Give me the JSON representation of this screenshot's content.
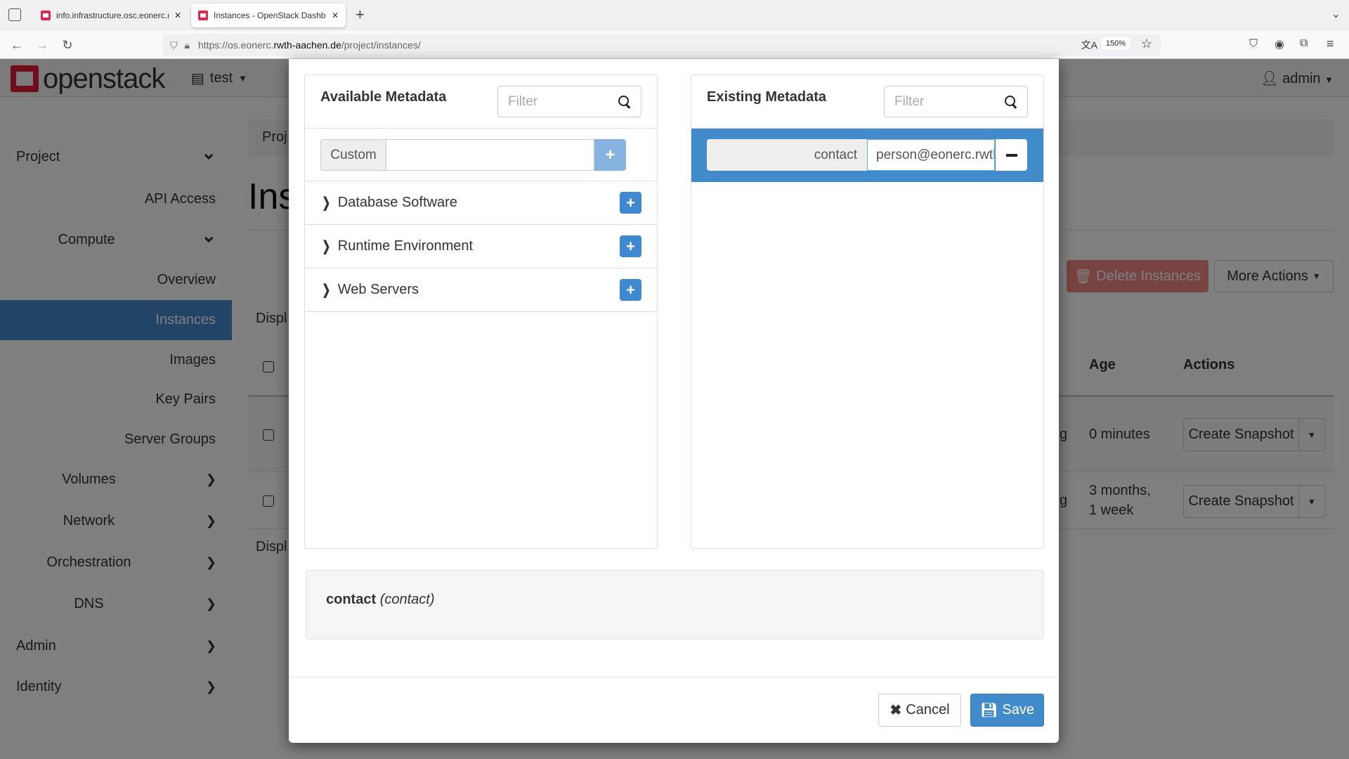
{
  "browser": {
    "tabs": [
      {
        "title": "info.infrastructure.osc.eonerc.rwth"
      },
      {
        "title": "Instances - OpenStack Dashboard",
        "active": true
      }
    ],
    "url_host_prefix": "https://os.eonerc.",
    "url_host_main": "rwth-aachen.de",
    "url_path": "/project/instances/",
    "zoom": "150%"
  },
  "header": {
    "logo": "openstack",
    "project": "test",
    "user": "admin"
  },
  "sidebar": {
    "items": [
      {
        "label": "Project",
        "level": "top",
        "icon": "chevron-down"
      },
      {
        "label": "API Access",
        "level": "sub"
      },
      {
        "label": "Compute",
        "level": "mid",
        "icon": "chevron-down"
      },
      {
        "label": "Overview",
        "level": "sub"
      },
      {
        "label": "Instances",
        "level": "sub",
        "active": true
      },
      {
        "label": "Images",
        "level": "sub"
      },
      {
        "label": "Key Pairs",
        "level": "sub"
      },
      {
        "label": "Server Groups",
        "level": "sub"
      },
      {
        "label": "Volumes",
        "level": "mid",
        "icon": "chevron-right"
      },
      {
        "label": "Network",
        "level": "mid",
        "icon": "chevron-right"
      },
      {
        "label": "Orchestration",
        "level": "mid",
        "icon": "chevron-right"
      },
      {
        "label": "DNS",
        "level": "mid",
        "icon": "chevron-right"
      },
      {
        "label": "Admin",
        "level": "top",
        "icon": "chevron-right"
      },
      {
        "label": "Identity",
        "level": "top",
        "icon": "chevron-right"
      }
    ]
  },
  "page": {
    "breadcrumb": "Proj",
    "title": "Ins",
    "display_top": "Displ",
    "display_bottom": "Displ",
    "delete_button": "Delete Instances",
    "more_actions": "More Actions",
    "columns": {
      "age": "Age",
      "actions": "Actions"
    },
    "rows": [
      {
        "status_tail": "g",
        "age": "0 minutes",
        "action": "Create Snapshot"
      },
      {
        "status_tail": "g",
        "age_line1": "3 months,",
        "age_line2": "1 week",
        "action": "Create Snapshot"
      }
    ]
  },
  "modal": {
    "available": {
      "title": "Available Metadata",
      "filter_placeholder": "Filter",
      "custom_label": "Custom",
      "custom_value": "",
      "groups": [
        "Database Software",
        "Runtime Environment",
        "Web Servers"
      ]
    },
    "existing": {
      "title": "Existing Metadata",
      "filter_placeholder": "Filter",
      "items": [
        {
          "key": "contact",
          "value": "person@eonerc.rwth-aachen.de"
        }
      ]
    },
    "description": {
      "name": "contact",
      "key": "(contact)"
    },
    "cancel_label": "Cancel",
    "save_label": "Save"
  },
  "colors": {
    "primary": "#428bca",
    "danger": "#d9534f",
    "brand": "#da1a32"
  }
}
